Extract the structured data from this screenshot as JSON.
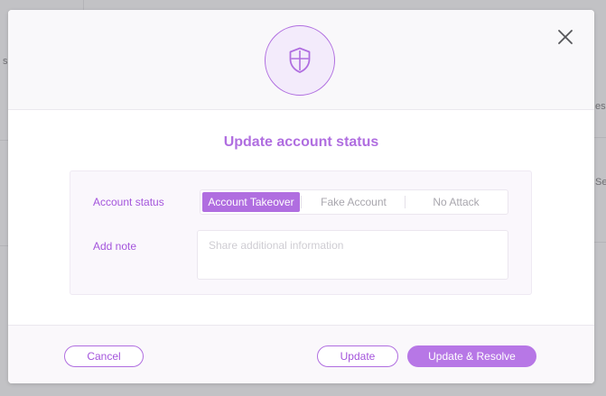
{
  "background": {
    "fragments": [
      "s",
      "es",
      "Sel"
    ]
  },
  "dialog": {
    "header": {
      "icon": "shield-icon",
      "close_icon": "close-icon"
    },
    "title": "Update account status",
    "form": {
      "status_label": "Account status",
      "status_options": [
        "Account Takeover",
        "Fake Account",
        "No Attack"
      ],
      "selected_option": "Account Takeover",
      "note_label": "Add note",
      "note_value": "",
      "note_placeholder": "Share additional information"
    },
    "footer": {
      "cancel_label": "Cancel",
      "update_label": "Update",
      "update_resolve_label": "Update & Resolve"
    }
  },
  "colors": {
    "accent": "#b06ee0",
    "primary_button": "#b777e6",
    "label_text": "#a455dc"
  }
}
